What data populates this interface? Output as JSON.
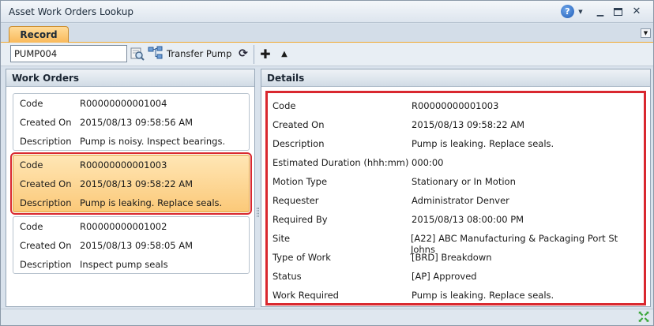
{
  "window": {
    "title": "Asset Work Orders Lookup"
  },
  "tabs": [
    {
      "label": "Record"
    }
  ],
  "toolbar": {
    "search_value": "PUMP004",
    "transfer_label": "Transfer Pump"
  },
  "work_orders_panel": {
    "header": "Work Orders",
    "items": [
      {
        "code_label": "Code",
        "code": "R00000000001004",
        "created_label": "Created On",
        "created": "2015/08/13 09:58:56 AM",
        "desc_label": "Description",
        "description": "Pump is noisy. Inspect bearings."
      },
      {
        "code_label": "Code",
        "code": "R00000000001003",
        "created_label": "Created On",
        "created": "2015/08/13 09:58:22 AM",
        "desc_label": "Description",
        "description": "Pump is leaking. Replace seals."
      },
      {
        "code_label": "Code",
        "code": "R00000000001002",
        "created_label": "Created On",
        "created": "2015/08/13 09:58:05 AM",
        "desc_label": "Description",
        "description": "Inspect pump seals"
      }
    ]
  },
  "details_panel": {
    "header": "Details",
    "fields": [
      {
        "label": "Code",
        "value": "R00000000001003"
      },
      {
        "label": "Created On",
        "value": "2015/08/13 09:58:22 AM"
      },
      {
        "label": "Description",
        "value": "Pump is leaking. Replace seals."
      },
      {
        "label": "Estimated Duration (hhh:mm)",
        "value": "000:00"
      },
      {
        "label": "Motion Type",
        "value": "Stationary or In Motion"
      },
      {
        "label": "Requester",
        "value": "Administrator Denver"
      },
      {
        "label": "Required By",
        "value": "2015/08/13 08:00:00 PM"
      },
      {
        "label": "Site",
        "value": "[A22] ABC Manufacturing & Packaging Port St Johns"
      },
      {
        "label": "Type of Work",
        "value": "[BRD] Breakdown"
      },
      {
        "label": "Status",
        "value": "[AP] Approved"
      },
      {
        "label": "Work Required",
        "value": "Pump is leaking. Replace seals."
      }
    ]
  },
  "colors": {
    "accent": "#f9b95a",
    "highlight_border": "#d9282f",
    "selected_card": "#fbc979"
  }
}
